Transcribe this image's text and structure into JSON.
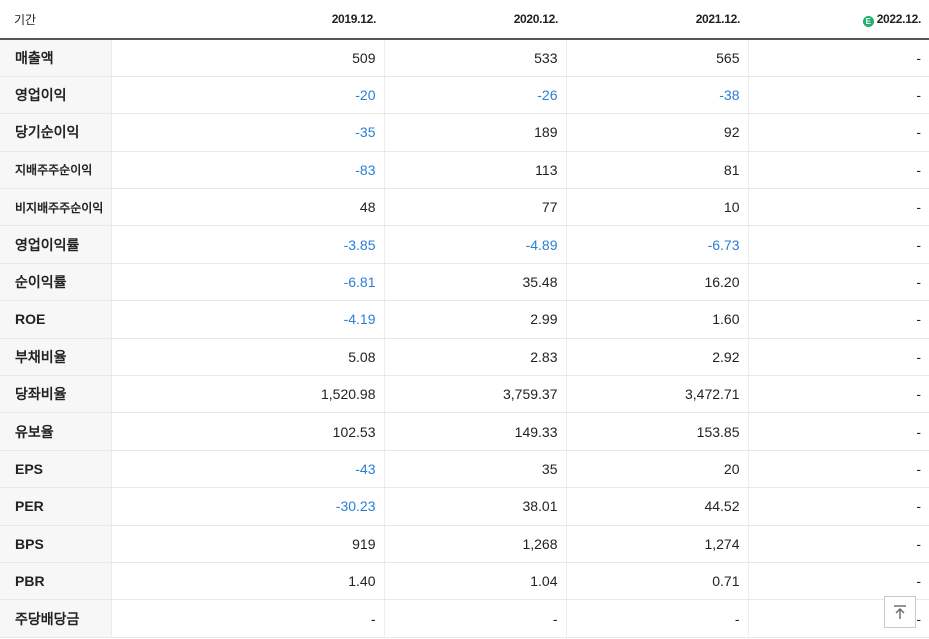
{
  "header": {
    "label": "기간",
    "years": [
      "2019.12.",
      "2020.12.",
      "2021.12.",
      "2022.12."
    ],
    "estimate_icon": "E"
  },
  "rows": [
    {
      "label": "매출액",
      "values": [
        "509",
        "533",
        "565",
        "-"
      ]
    },
    {
      "label": "영업이익",
      "values": [
        "-20",
        "-26",
        "-38",
        "-"
      ]
    },
    {
      "label": "당기순이익",
      "values": [
        "-35",
        "189",
        "92",
        "-"
      ]
    },
    {
      "label": "지배주주순이익",
      "values": [
        "-83",
        "113",
        "81",
        "-"
      ]
    },
    {
      "label": "비지배주주순이익",
      "values": [
        "48",
        "77",
        "10",
        "-"
      ]
    },
    {
      "label": "영업이익률",
      "values": [
        "-3.85",
        "-4.89",
        "-6.73",
        "-"
      ]
    },
    {
      "label": "순이익률",
      "values": [
        "-6.81",
        "35.48",
        "16.20",
        "-"
      ]
    },
    {
      "label": "ROE",
      "values": [
        "-4.19",
        "2.99",
        "1.60",
        "-"
      ]
    },
    {
      "label": "부채비율",
      "values": [
        "5.08",
        "2.83",
        "2.92",
        "-"
      ]
    },
    {
      "label": "당좌비율",
      "values": [
        "1,520.98",
        "3,759.37",
        "3,472.71",
        "-"
      ]
    },
    {
      "label": "유보율",
      "values": [
        "102.53",
        "149.33",
        "153.85",
        "-"
      ]
    },
    {
      "label": "EPS",
      "values": [
        "-43",
        "35",
        "20",
        "-"
      ]
    },
    {
      "label": "PER",
      "values": [
        "-30.23",
        "38.01",
        "44.52",
        "-"
      ]
    },
    {
      "label": "BPS",
      "values": [
        "919",
        "1,268",
        "1,274",
        "-"
      ]
    },
    {
      "label": "PBR",
      "values": [
        "1.40",
        "1.04",
        "0.71",
        "-"
      ]
    },
    {
      "label": "주당배당금",
      "values": [
        "-",
        "-",
        "-",
        "-"
      ]
    }
  ],
  "colors": {
    "negative": "#2a7fd4",
    "estimate_badge": "#1eb06e",
    "label_bg": "#f7f7f7"
  },
  "icons": {
    "scroll_top": "arrow-up-to-line-icon",
    "estimate": "estimate-badge-icon"
  }
}
